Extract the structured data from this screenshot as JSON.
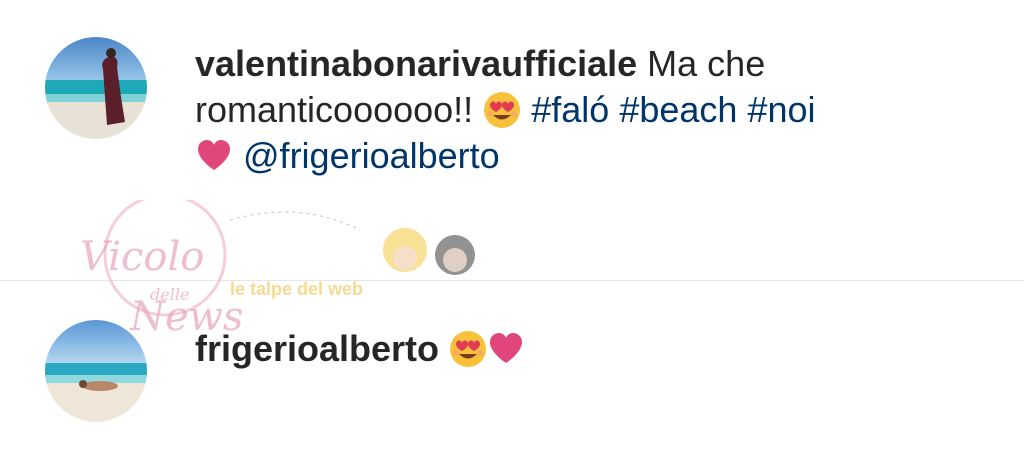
{
  "comments": [
    {
      "username": "valentinabonarivaufficiale",
      "text_1": "Ma che romanticoooooo!!",
      "emoji_1": "smiling-face-with-heart-eyes",
      "hashtags": [
        "#faló",
        "#beach",
        "#noi"
      ],
      "emoji_2": "heart",
      "mention": "@frigerioalberto"
    },
    {
      "username": "frigerioalberto",
      "emoji_1": "smiling-face-with-heart-eyes",
      "emoji_2": "heart"
    }
  ],
  "watermark": {
    "line_1": "Vicolo",
    "line_2": "delle",
    "line_3": "News",
    "line_4": "le talpe del web"
  },
  "colors": {
    "text": "#262626",
    "link": "#003569",
    "heart": "#e0457b",
    "divider": "#e6e6e6"
  }
}
